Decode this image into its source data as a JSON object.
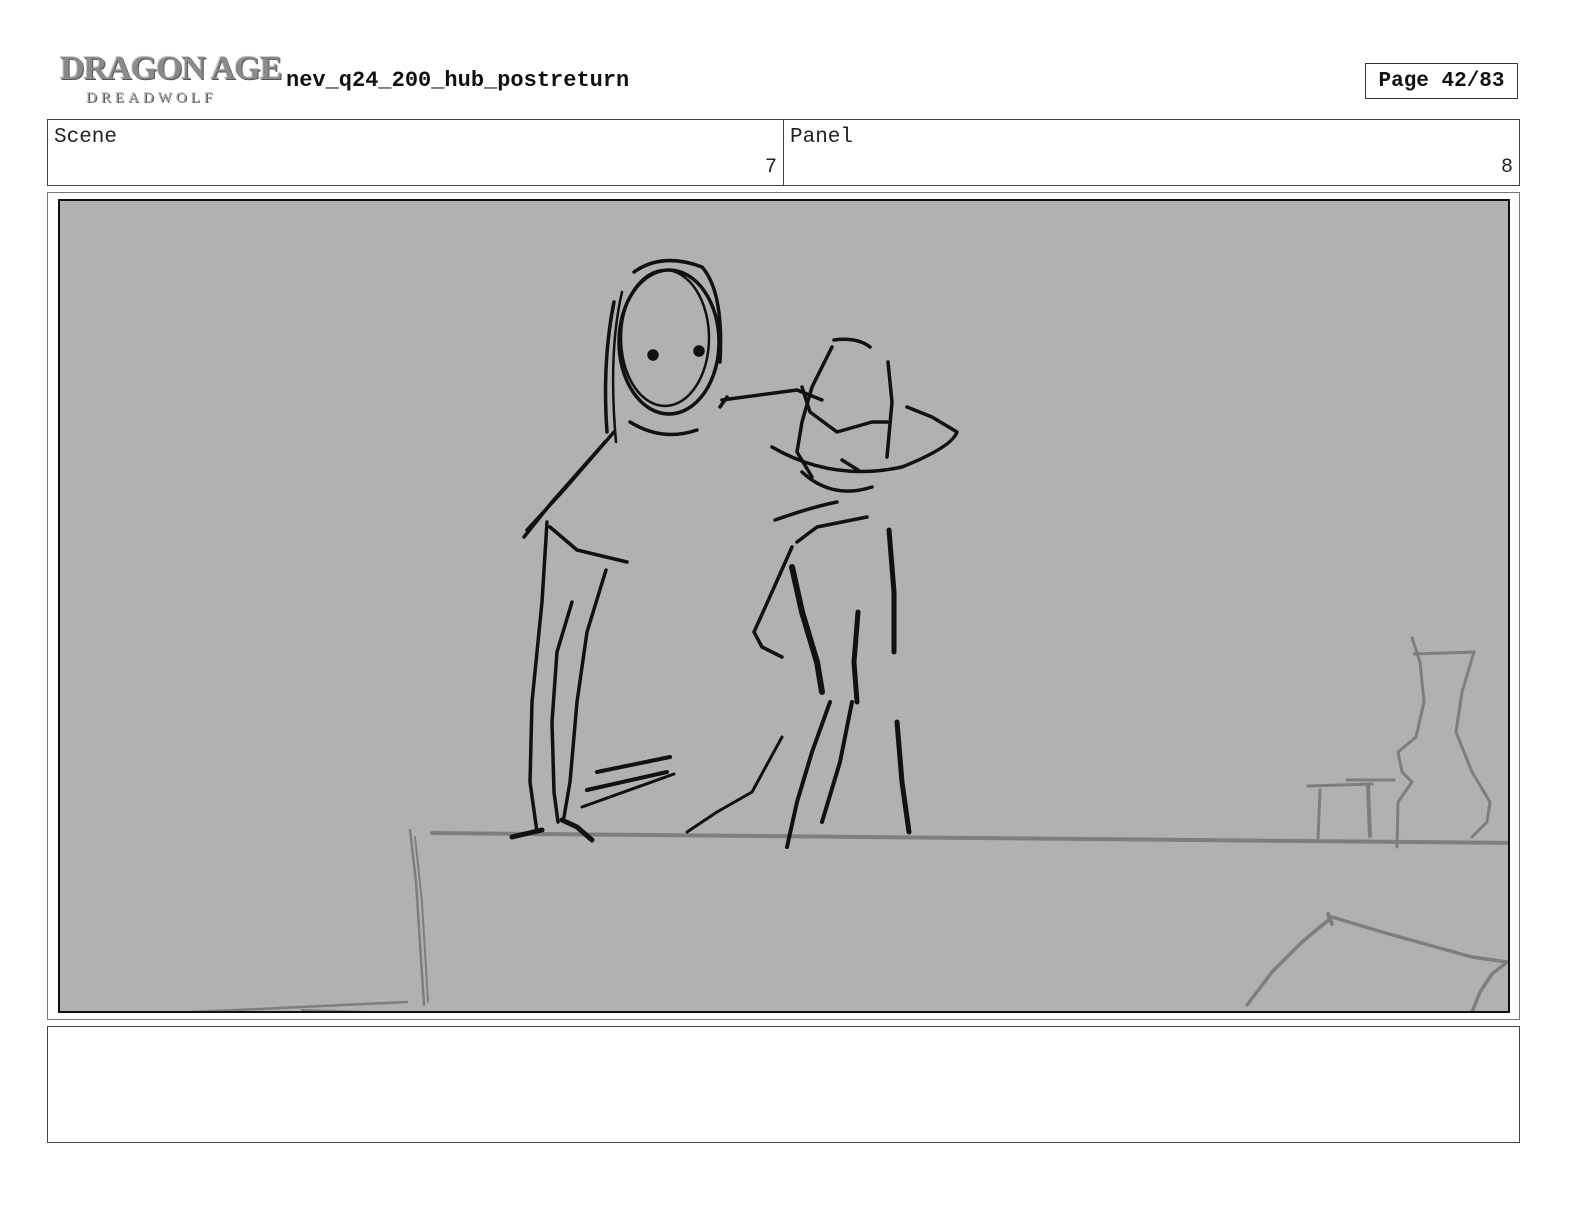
{
  "header": {
    "logo": {
      "title": "DRAGON AGE",
      "subtitle": "DREADWOLF"
    },
    "doc_title": "nev_q24_200_hub_postreturn",
    "page_label": "Page 42/83"
  },
  "info": {
    "scene_label": "Scene",
    "scene_value": "7",
    "panel_label": "Panel",
    "panel_value": "8"
  },
  "notes": {
    "text": ""
  }
}
